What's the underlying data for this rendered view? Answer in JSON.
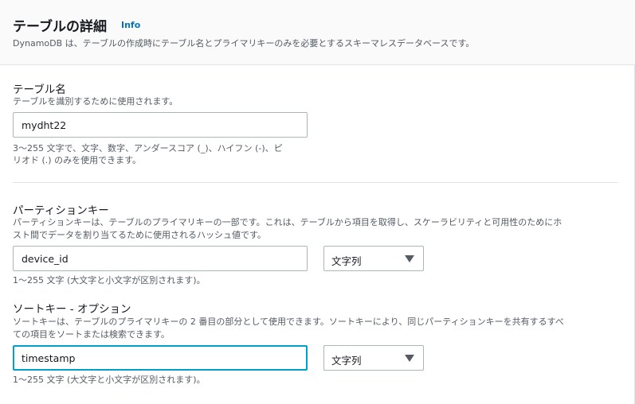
{
  "header": {
    "title": "テーブルの詳細",
    "info_label": "Info",
    "description": "DynamoDB は、テーブルの作成時にテーブル名とプライマリキーのみを必要とするスキーマレスデータベースです。"
  },
  "table_name": {
    "label": "テーブル名",
    "description": "テーブルを識別するために使用されます。",
    "value": "mydht22",
    "hint_line1": "3〜255 文字で、文字、数字、アンダースコア (_)、ハイフン (-)、ピ",
    "hint_line2": "リオド (.) のみを使用できます。"
  },
  "partition_key": {
    "label": "パーティションキー",
    "description_line1": "パーティションキーは、テーブルのプライマリキーの一部です。これは、テーブルから項目を取得し、スケーラビリティと可用性のためにホ",
    "description_line2": "スト間でデータを割り当てるために使用されるハッシュ値です。",
    "value": "device_id",
    "type": "文字列",
    "hint": "1〜255 文字 (大文字と小文字が区別されます)。"
  },
  "sort_key": {
    "label": "ソートキー - オプション",
    "description_line1": "ソートキーは、テーブルのプライマリキーの 2 番目の部分として使用できます。ソートキーにより、同じパーティションキーを共有するすべ",
    "description_line2": "ての項目をソートまたは検索できます。",
    "value": "timestamp",
    "type": "文字列",
    "hint": "1〜255 文字 (大文字と小文字が区別されます)。"
  },
  "colors": {
    "accent": "#0073bb",
    "focus": "#00a1c9",
    "text": "#16191f",
    "muted": "#545b64"
  }
}
